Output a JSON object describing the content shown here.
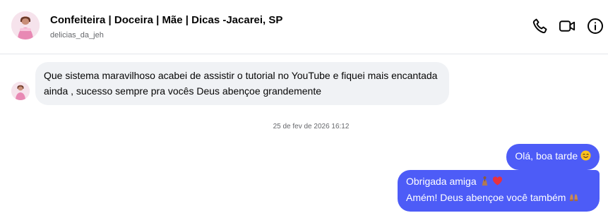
{
  "header": {
    "name": "Confeiteira | Doceira | Mãe | Dicas -Jacarei, SP",
    "handle": "delicias_da_jeh",
    "actions": [
      "phone-icon",
      "video-call-icon",
      "info-icon"
    ]
  },
  "messages": {
    "incoming": {
      "text": "Que sistema maravilhoso acabei de assistir o tutorial no YouTube e fiquei mais encantada ainda , sucesso sempre pra vocês Deus abençoe grandemente"
    },
    "timestamp": "25 de fev de 2026 16:12",
    "outgoing_1": {
      "text": "Olá, boa tarde"
    },
    "outgoing_2": {
      "line1": "Obrigada amiga",
      "line2": "Amém! Deus abençoe você também"
    }
  },
  "colors": {
    "outgoing_bubble": "#4d5cf7",
    "incoming_bubble": "#f0f2f5",
    "accent_heart": "#e8313f"
  }
}
